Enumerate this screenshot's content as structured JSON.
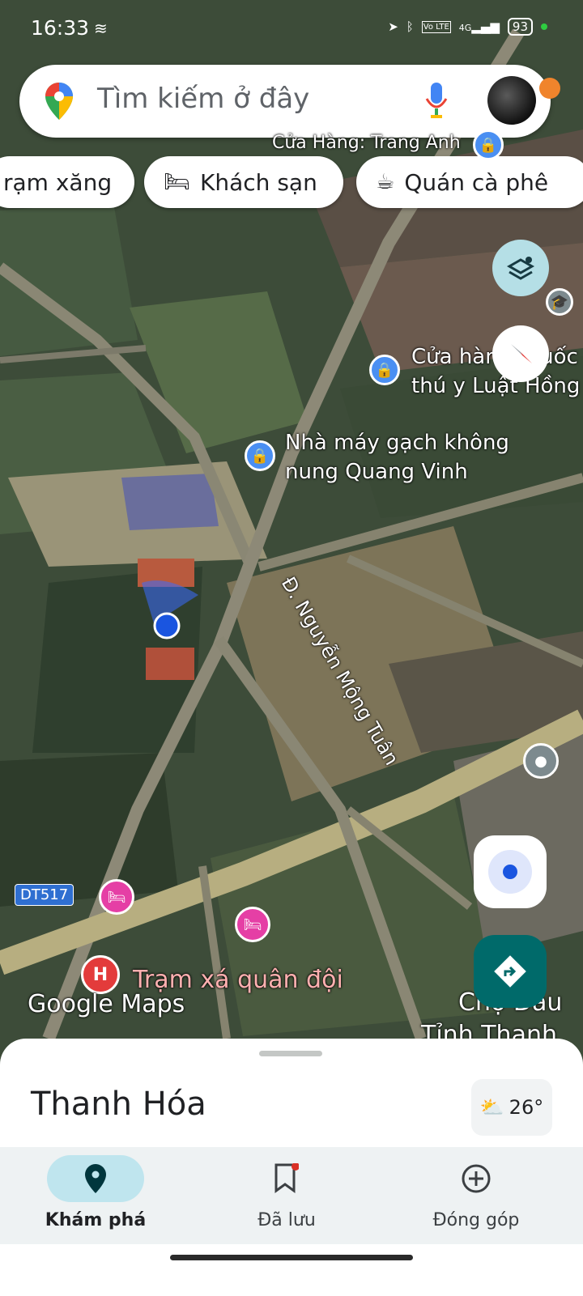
{
  "status_bar": {
    "time": "16:33",
    "network": "4G",
    "volte": "Vo LTE",
    "battery": "93"
  },
  "search": {
    "placeholder": "Tìm kiếm ở đây"
  },
  "chips": [
    {
      "label": "rạm xăng",
      "icon": "gas-station-icon"
    },
    {
      "label": "Khách sạn",
      "icon": "bed-icon"
    },
    {
      "label": "Quán cà phê",
      "icon": "coffee-cup-icon"
    }
  ],
  "map": {
    "labels": {
      "shop_top": "Cửa Hàng: Trang Anh",
      "vet_store_line1": "Cửa hàng thuốc",
      "vet_store_line2": "thú y Luật Hồng",
      "brick_factory_line1": "Nhà máy gạch không",
      "brick_factory_line2": "nung Quang Vinh",
      "road_name": "Đ. Nguyễn Mộng Tuân",
      "route_shield": "DT517",
      "clinic": "Trạm xá quân đội",
      "market_line1": "Chợ Dầu",
      "market_line2": "Tỉnh Thanh",
      "watermark": "Google Maps"
    },
    "colors": {
      "accent_teal": "#006a6a",
      "hotel_pink": "#e53fa5",
      "hospital_red": "#e33b3b",
      "shop_blue": "#4a8ff2",
      "location_blue": "#1a55e0"
    }
  },
  "sheet": {
    "place_name": "Thanh Hóa",
    "weather_temp": "26°",
    "weather_icon": "partly-sunny-icon"
  },
  "bottom_nav": [
    {
      "label": "Khám phá",
      "icon": "location-pin-icon",
      "active": true
    },
    {
      "label": "Đã lưu",
      "icon": "bookmark-icon",
      "active": false
    },
    {
      "label": "Đóng góp",
      "icon": "add-circle-icon",
      "active": false
    }
  ]
}
